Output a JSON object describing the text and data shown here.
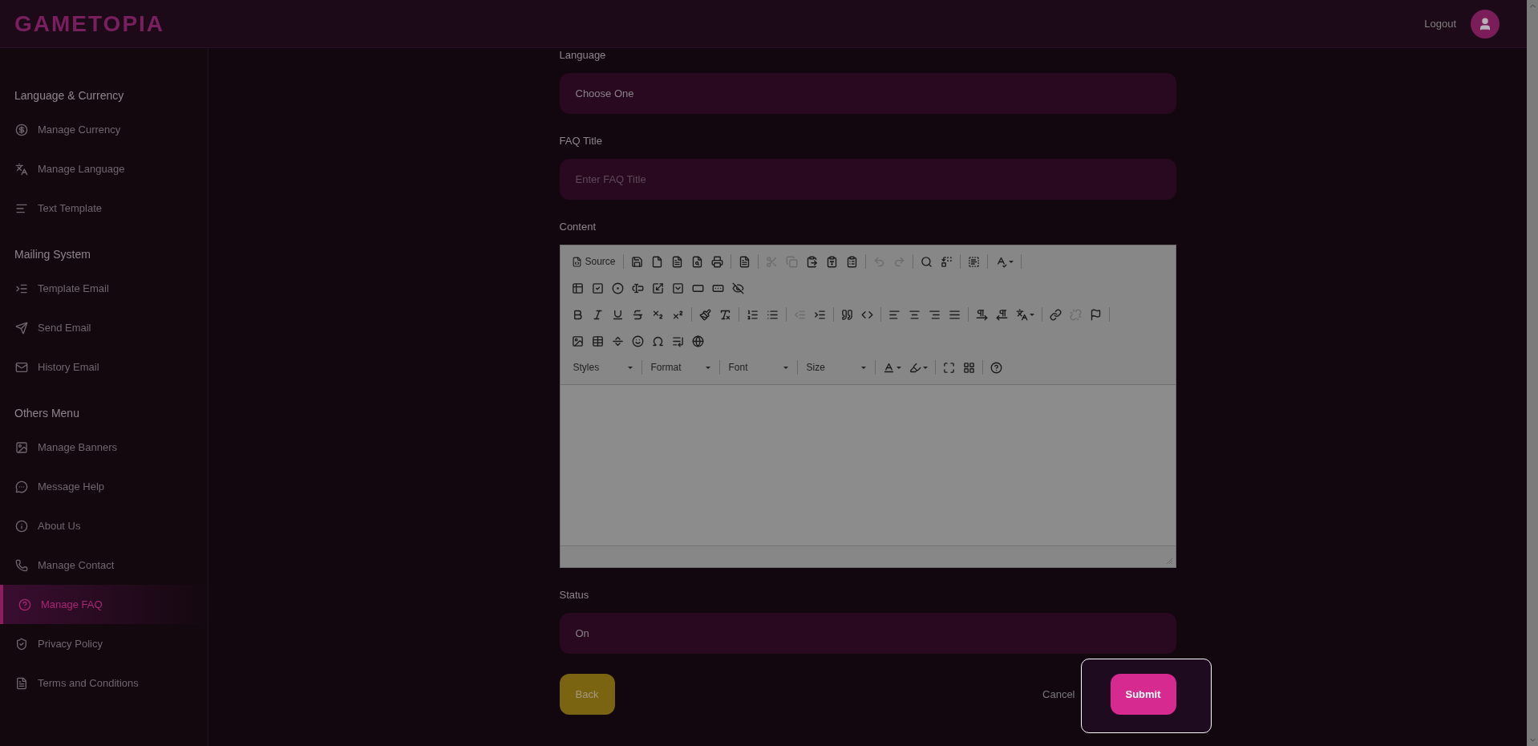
{
  "header": {
    "logo": "GAMETOPIA",
    "logout": "Logout"
  },
  "sidebar": {
    "sections": [
      {
        "title": "Language & Currency",
        "items": [
          {
            "label": "Manage Currency",
            "selected": false
          },
          {
            "label": "Manage Language",
            "selected": false
          },
          {
            "label": "Text Template",
            "selected": false
          }
        ]
      },
      {
        "title": "Mailing System",
        "items": [
          {
            "label": "Template Email",
            "selected": false
          },
          {
            "label": "Send Email",
            "selected": false
          },
          {
            "label": "History Email",
            "selected": false
          }
        ]
      },
      {
        "title": "Others Menu",
        "items": [
          {
            "label": "Manage Banners",
            "selected": false
          },
          {
            "label": "Message Help",
            "selected": false
          },
          {
            "label": "About Us",
            "selected": false
          },
          {
            "label": "Manage Contact",
            "selected": false
          },
          {
            "label": "Manage FAQ",
            "selected": true
          },
          {
            "label": "Privacy Policy",
            "selected": false
          },
          {
            "label": "Terms and Conditions",
            "selected": false
          }
        ]
      }
    ]
  },
  "form": {
    "fields": [
      {
        "kind": "select",
        "label": "Language",
        "value": "Choose One"
      },
      {
        "kind": "input",
        "label": "FAQ Title",
        "placeholder": "Enter FAQ Title"
      },
      {
        "kind": "editor",
        "label": "Content",
        "toolbar": [
          {
            "end_rule": true,
            "groups": [
              [
                {
                  "kind": "text",
                  "label": "Source",
                  "disabled": false
                }
              ],
              [
                {
                  "kind": "button",
                  "disabled": false
                },
                {
                  "kind": "button",
                  "disabled": false
                },
                {
                  "kind": "button",
                  "disabled": false
                },
                {
                  "kind": "button",
                  "disabled": false
                },
                {
                  "kind": "button",
                  "disabled": false
                }
              ],
              [
                {
                  "kind": "button",
                  "disabled": false
                }
              ],
              [
                {
                  "kind": "button",
                  "disabled": true
                },
                {
                  "kind": "button",
                  "disabled": true
                },
                {
                  "kind": "button",
                  "disabled": false
                },
                {
                  "kind": "button",
                  "disabled": false
                },
                {
                  "kind": "button",
                  "disabled": false
                }
              ],
              [
                {
                  "kind": "button",
                  "disabled": true
                },
                {
                  "kind": "button",
                  "disabled": true
                }
              ],
              [
                {
                  "kind": "button",
                  "disabled": false
                },
                {
                  "kind": "button",
                  "disabled": false
                }
              ],
              [
                {
                  "kind": "button",
                  "disabled": false
                }
              ],
              [
                {
                  "kind": "menu",
                  "disabled": false
                }
              ]
            ]
          },
          {
            "end_rule": false,
            "groups": [
              [
                {
                  "kind": "button",
                  "disabled": false
                },
                {
                  "kind": "button",
                  "disabled": false
                },
                {
                  "kind": "button",
                  "disabled": false
                },
                {
                  "kind": "button",
                  "disabled": false
                },
                {
                  "kind": "button",
                  "disabled": false
                },
                {
                  "kind": "button",
                  "disabled": false
                },
                {
                  "kind": "button",
                  "disabled": false
                },
                {
                  "kind": "button",
                  "disabled": false
                },
                {
                  "kind": "button",
                  "disabled": false
                }
              ]
            ]
          },
          {
            "end_rule": true,
            "groups": [
              [
                {
                  "kind": "button",
                  "disabled": false
                },
                {
                  "kind": "button",
                  "disabled": false
                },
                {
                  "kind": "button",
                  "disabled": false
                },
                {
                  "kind": "button",
                  "disabled": false
                },
                {
                  "kind": "button",
                  "disabled": false
                },
                {
                  "kind": "button",
                  "disabled": false
                }
              ],
              [
                {
                  "kind": "button",
                  "disabled": false
                },
                {
                  "kind": "button",
                  "disabled": false
                }
              ],
              [
                {
                  "kind": "button",
                  "disabled": false
                },
                {
                  "kind": "button",
                  "disabled": false
                }
              ],
              [
                {
                  "kind": "button",
                  "disabled": true
                },
                {
                  "kind": "button",
                  "disabled": false
                }
              ],
              [
                {
                  "kind": "button",
                  "disabled": false
                },
                {
                  "kind": "button",
                  "disabled": false
                }
              ],
              [
                {
                  "kind": "button",
                  "disabled": false
                },
                {
                  "kind": "button",
                  "disabled": false
                },
                {
                  "kind": "button",
                  "disabled": false
                },
                {
                  "kind": "button",
                  "disabled": false
                }
              ],
              [
                {
                  "kind": "button",
                  "disabled": false
                },
                {
                  "kind": "button",
                  "disabled": false
                },
                {
                  "kind": "menu",
                  "disabled": false
                }
              ],
              [
                {
                  "kind": "button",
                  "disabled": false
                },
                {
                  "kind": "button",
                  "disabled": true
                },
                {
                  "kind": "button",
                  "disabled": false
                }
              ]
            ]
          },
          {
            "end_rule": false,
            "groups": [
              [
                {
                  "kind": "button",
                  "disabled": false
                },
                {
                  "kind": "button",
                  "disabled": false
                },
                {
                  "kind": "button",
                  "disabled": false
                },
                {
                  "kind": "button",
                  "disabled": false
                },
                {
                  "kind": "button",
                  "disabled": false
                },
                {
                  "kind": "button",
                  "disabled": false
                },
                {
                  "kind": "button",
                  "disabled": false
                }
              ]
            ]
          },
          {
            "end_rule": false,
            "groups": [
              [
                {
                  "kind": "combo",
                  "label": "Styles"
                }
              ],
              [
                {
                  "kind": "combo",
                  "label": "Format"
                }
              ],
              [
                {
                  "kind": "combo",
                  "label": "Font"
                }
              ],
              [
                {
                  "kind": "combo",
                  "label": "Size"
                }
              ],
              [
                {
                  "kind": "menu",
                  "disabled": false
                },
                {
                  "kind": "menu",
                  "disabled": false
                }
              ],
              [
                {
                  "kind": "button",
                  "disabled": false
                },
                {
                  "kind": "button",
                  "disabled": false
                }
              ],
              [
                {
                  "kind": "button",
                  "disabled": false
                }
              ]
            ]
          }
        ]
      },
      {
        "kind": "select",
        "label": "Status",
        "value": "On"
      }
    ],
    "actions": {
      "back": "Back",
      "cancel": "Cancel",
      "submit": "Submit"
    }
  }
}
